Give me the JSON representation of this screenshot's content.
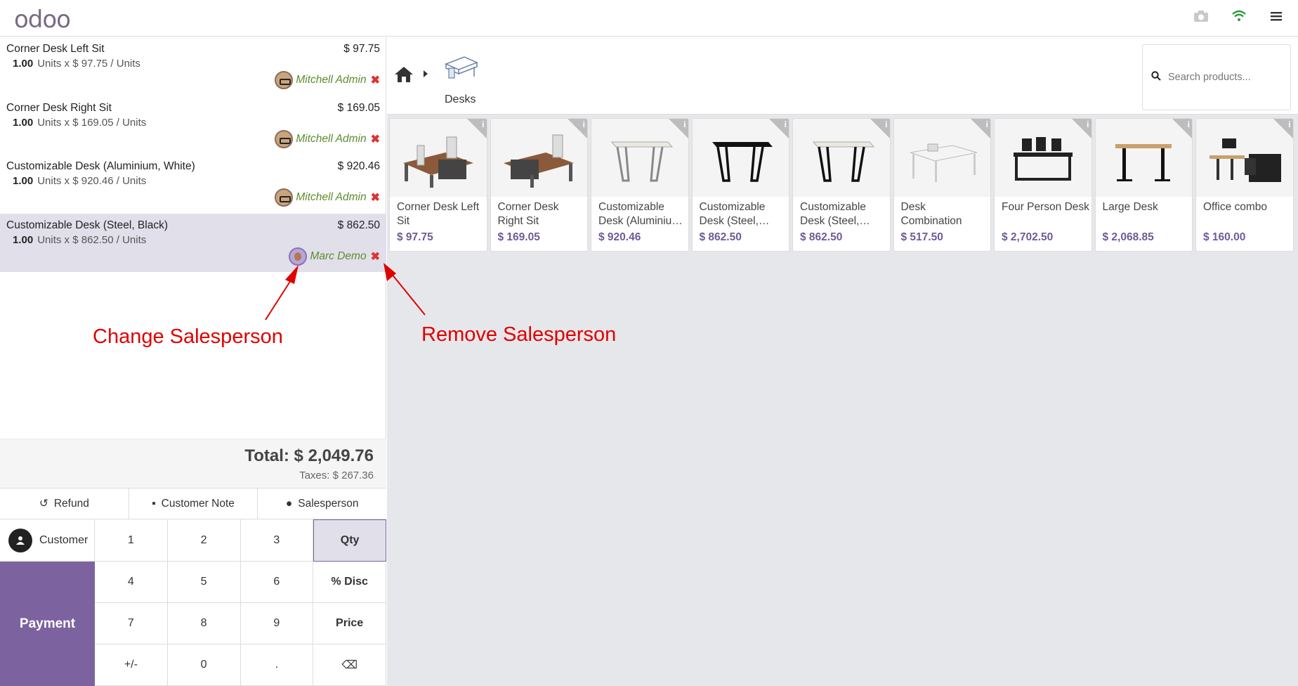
{
  "app": {
    "logo": "odoo"
  },
  "topbar_icons": [
    "camera-icon",
    "wifi-icon",
    "menu-icon"
  ],
  "orderlines": [
    {
      "name": "Corner Desk Left Sit",
      "price": "$ 97.75",
      "qty": "1.00",
      "unit_text": "Units x $ 97.75 / Units",
      "salesperson": "Mitchell Admin",
      "selected": false
    },
    {
      "name": "Corner Desk Right Sit",
      "price": "$ 169.05",
      "qty": "1.00",
      "unit_text": "Units x $ 169.05 / Units",
      "salesperson": "Mitchell Admin",
      "selected": false
    },
    {
      "name": "Customizable Desk (Aluminium, White)",
      "price": "$ 920.46",
      "qty": "1.00",
      "unit_text": "Units x $ 920.46 / Units",
      "salesperson": "Mitchell Admin",
      "selected": false
    },
    {
      "name": "Customizable Desk (Steel, Black)",
      "price": "$ 862.50",
      "qty": "1.00",
      "unit_text": "Units x $ 862.50 / Units",
      "salesperson": "Marc Demo",
      "selected": true
    }
  ],
  "annotations": {
    "change": "Change Salesperson",
    "remove": "Remove Salesperson"
  },
  "totals": {
    "total": "Total: $ 2,049.76",
    "taxes": "Taxes: $ 267.36"
  },
  "controls": {
    "refund": "Refund",
    "note": "Customer Note",
    "salesperson": "Salesperson"
  },
  "pad": {
    "customer": "Customer",
    "payment": "Payment",
    "keys": [
      "1",
      "2",
      "3",
      "Qty",
      "4",
      "5",
      "6",
      "% Disc",
      "7",
      "8",
      "9",
      "Price",
      "+/-",
      "0",
      ".",
      "⌫"
    ],
    "active_key": "Qty"
  },
  "breadcrumb": {
    "category": "Desks"
  },
  "search": {
    "placeholder": "Search products..."
  },
  "products": [
    {
      "name": "Corner Desk Left Sit",
      "price": "$ 97.75"
    },
    {
      "name": "Corner Desk Right Sit",
      "price": "$ 169.05"
    },
    {
      "name": "Customizable Desk (Aluminiu…",
      "price": "$ 920.46"
    },
    {
      "name": "Customizable Desk (Steel,…",
      "price": "$ 862.50"
    },
    {
      "name": "Customizable Desk (Steel,…",
      "price": "$ 862.50"
    },
    {
      "name": "Desk Combination",
      "price": "$ 517.50"
    },
    {
      "name": "Four Person Desk",
      "price": "$ 2,702.50"
    },
    {
      "name": "Large Desk",
      "price": "$ 2,068.85"
    },
    {
      "name": "Office combo",
      "price": "$ 160.00"
    }
  ]
}
